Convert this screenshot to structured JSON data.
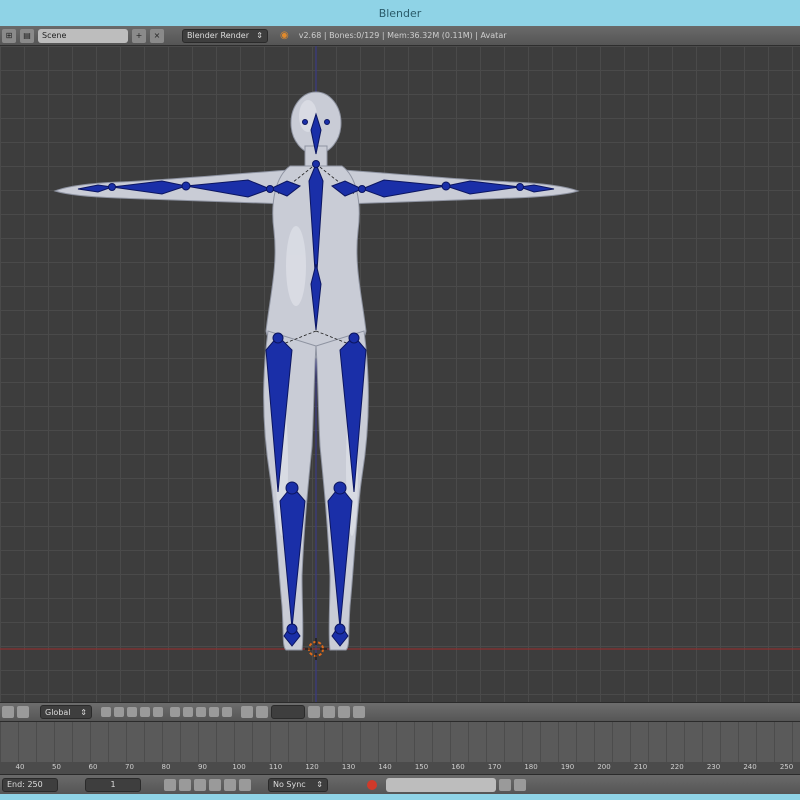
{
  "window": {
    "title": "Blender"
  },
  "info_header": {
    "scene_name": "Scene",
    "render_engine": "Blender Render",
    "stats": "v2.68 | Bones:0/129 | Mem:36.32M (0.11M) | Avatar"
  },
  "view3d_header": {
    "orientation": "Global"
  },
  "timeline": {
    "ruler_ticks": [
      "40",
      "50",
      "60",
      "70",
      "80",
      "90",
      "100",
      "110",
      "120",
      "130",
      "140",
      "150",
      "160",
      "170",
      "180",
      "190",
      "200",
      "210",
      "220",
      "230",
      "240",
      "250"
    ],
    "end_frame": "End: 250",
    "current_frame": "1",
    "sync_mode": "No Sync"
  },
  "colors": {
    "viewport_bg": "#3d3d3d",
    "bone": "#1a2fa8",
    "mesh": "#c9ccd6"
  }
}
